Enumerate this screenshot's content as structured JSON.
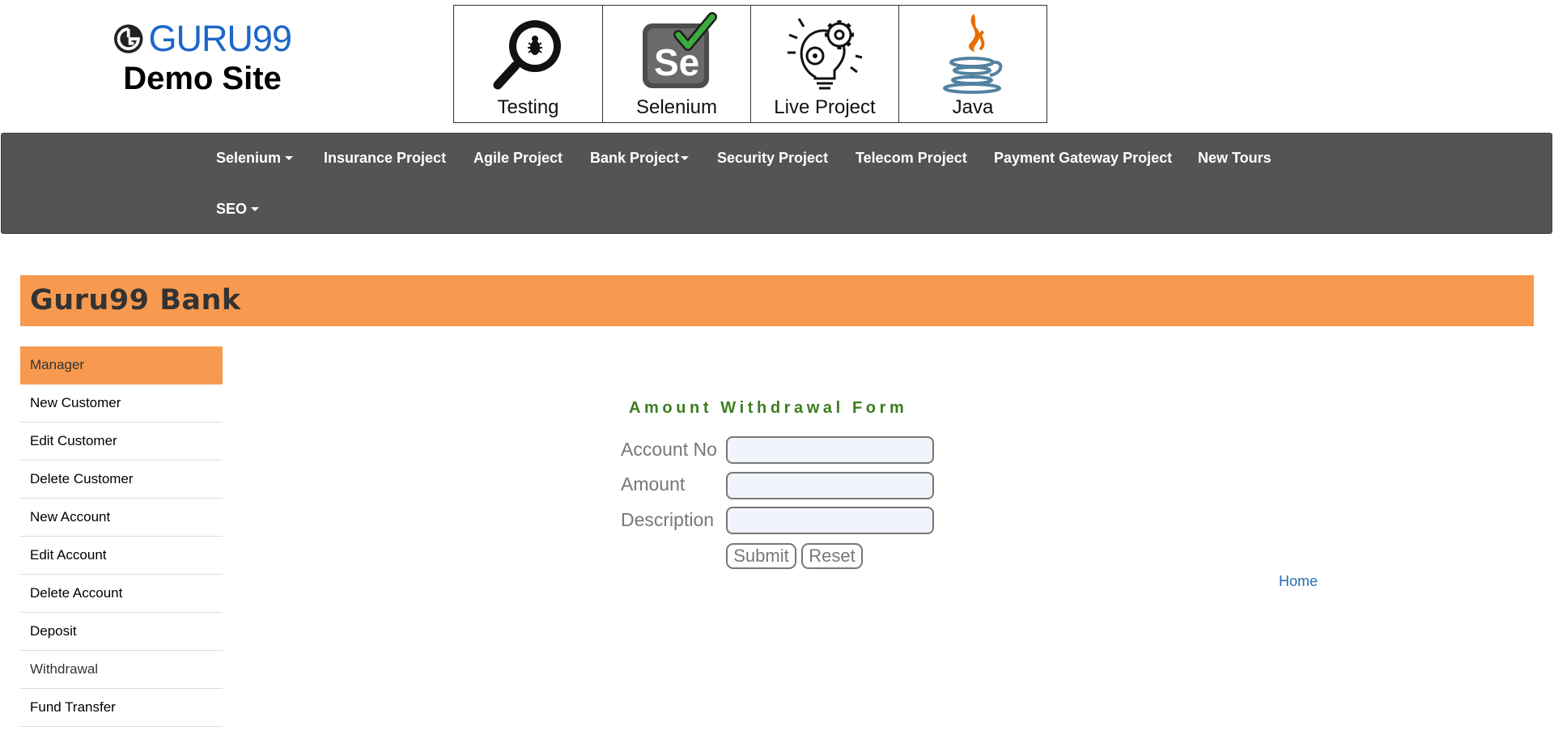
{
  "logo": {
    "word": "GURU99",
    "subtitle": "Demo Site"
  },
  "topics": [
    {
      "label": "Testing",
      "icon": "magnifier-bug-icon"
    },
    {
      "label": "Selenium",
      "icon": "selenium-check-icon"
    },
    {
      "label": "Live Project",
      "icon": "lightbulb-gear-icon"
    },
    {
      "label": "Java",
      "icon": "java-cup-icon"
    }
  ],
  "nav": {
    "items": [
      {
        "label": "Selenium",
        "dropdown": true
      },
      {
        "label": "Insurance Project",
        "dropdown": false
      },
      {
        "label": "Agile Project",
        "dropdown": false
      },
      {
        "label": "Bank Project",
        "dropdown": true
      },
      {
        "label": "Security Project",
        "dropdown": false
      },
      {
        "label": "Telecom Project",
        "dropdown": false
      },
      {
        "label": "Payment Gateway Project",
        "dropdown": false
      },
      {
        "label": "New Tours",
        "dropdown": false
      },
      {
        "label": "SEO",
        "dropdown": true
      }
    ]
  },
  "banner": {
    "title": "Guru99 Bank"
  },
  "sidebar": {
    "items": [
      {
        "label": "Manager"
      },
      {
        "label": "New Customer"
      },
      {
        "label": "Edit Customer"
      },
      {
        "label": "Delete Customer"
      },
      {
        "label": "New Account"
      },
      {
        "label": "Edit Account"
      },
      {
        "label": "Delete Account"
      },
      {
        "label": "Deposit"
      },
      {
        "label": "Withdrawal"
      },
      {
        "label": "Fund Transfer"
      }
    ]
  },
  "form": {
    "title": "Amount Withdrawal Form",
    "fields": [
      {
        "label": "Account No",
        "value": ""
      },
      {
        "label": "Amount",
        "value": ""
      },
      {
        "label": "Description",
        "value": ""
      }
    ],
    "submit_label": "Submit",
    "reset_label": "Reset"
  },
  "home_link": "Home",
  "colors": {
    "accent": "#f79a4f",
    "navbar": "#545454",
    "form_title": "#3b7d1f",
    "brand_blue": "#1d67c9",
    "link": "#2a6db5"
  }
}
